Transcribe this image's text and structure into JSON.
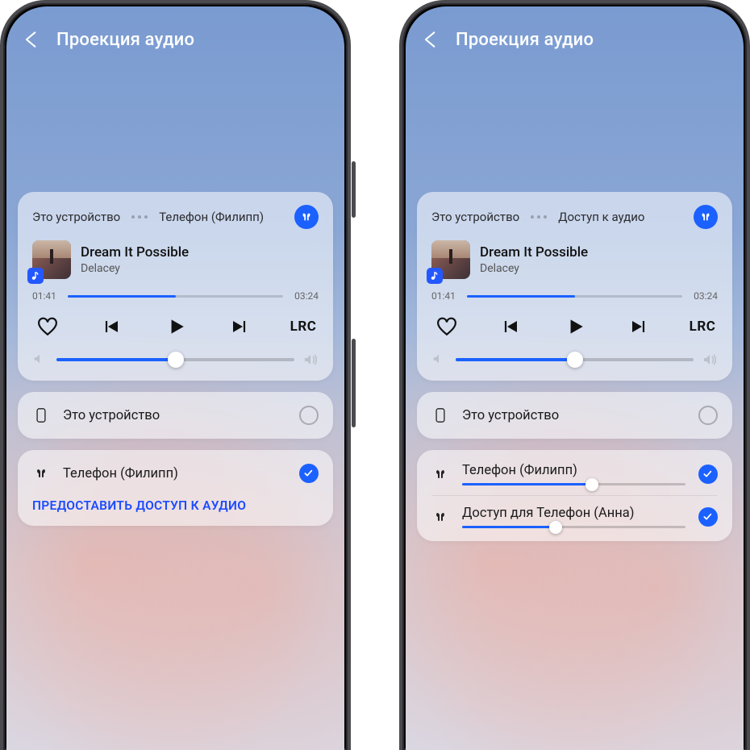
{
  "header": {
    "title": "Проекция аудио"
  },
  "player": {
    "tab_this_device": "Это устройство",
    "tab_phone_philipp": "Телефон (Филипп)",
    "tab_audio_access": "Доступ к аудио",
    "song_title": "Dream It Possible",
    "song_artist": "Delacey",
    "time_elapsed": "01:41",
    "time_total": "03:24",
    "progress_percent": 50,
    "volume_percent": 50,
    "lrc_label": "LRC"
  },
  "devices_left": {
    "this_device": "Это устройство",
    "phone_philipp": "Телефон (Филипп)",
    "share_audio": "ПРЕДОСТАВИТЬ ДОСТУП К АУДИО"
  },
  "devices_right": {
    "this_device": "Это устройство",
    "phone_philipp": "Телефон (Филипп)",
    "phone_anna": "Доступ для Телефон (Анна)",
    "philipp_volume_percent": 58,
    "anna_volume_percent": 42
  },
  "colors": {
    "accent": "#1b61ff"
  }
}
